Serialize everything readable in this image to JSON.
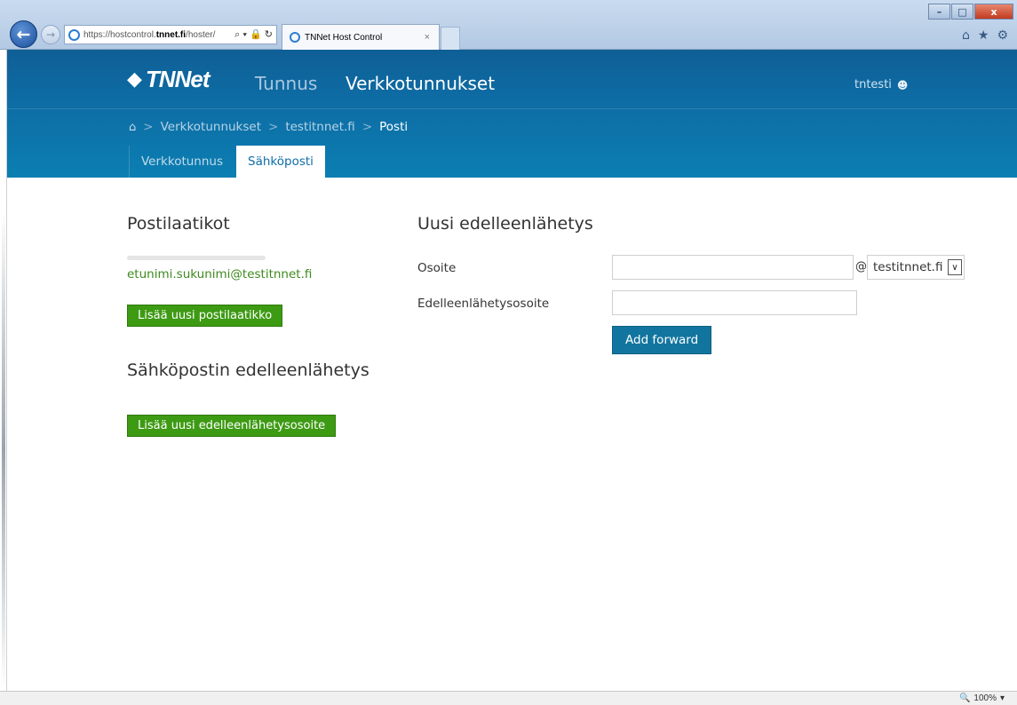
{
  "browser": {
    "address_prefix": "https://hostcontrol.",
    "address_domain": "tnnet.fi",
    "address_suffix": "/hoster/",
    "address_tools": "⌕ ▾ 🔒 ↻",
    "tab_title": "TNNet Host Control",
    "tab_close": "×",
    "back": "←",
    "forward": "→",
    "min": "–",
    "max": "□",
    "close": "x",
    "icons": [
      "home-icon",
      "favorites-star-icon",
      "settings-gear-icon"
    ],
    "icon_glyphs": [
      "⌂",
      "★",
      "⚙"
    ],
    "zoom_icon": "🔍",
    "zoom": "100%",
    "zoom_caret": "▾"
  },
  "header": {
    "logo_text": "TNNet",
    "logo_glyph": "◆",
    "nav_tunnus": "Tunnus",
    "nav_verkkotunnukset": "Verkkotunnukset",
    "username": "tntesti",
    "user_glyph": "☻"
  },
  "breadcrumb": {
    "home_glyph": "⌂",
    "sep": ">",
    "items": [
      "Verkkotunnukset",
      "testitnnet.fi",
      "Posti"
    ]
  },
  "tabs": [
    "Verkkotunnus",
    "Sähköposti"
  ],
  "left": {
    "mailboxes_title": "Postilaatikot",
    "mailbox": "etunimi.sukunimi@testitnnet.fi",
    "add_mailbox": "Lisää uusi postilaatikko",
    "forward_title": "Sähköpostin edelleenlähetys",
    "add_forward": "Lisää uusi edelleenlähetysosoite"
  },
  "form": {
    "title": "Uusi edelleenlähetys",
    "address_label": "Osoite",
    "address_value": "",
    "at": "@",
    "domain_selected": "testitnnet.fi",
    "domain_arrow": "∨",
    "forward_label": "Edelleenlähetysosoite",
    "forward_value": "",
    "submit": "Add forward"
  },
  "colors": {
    "navbar": "#0e6ea6",
    "green_button": "#3d9a13",
    "blue_button": "#12759f",
    "link_green": "#3d8a1d"
  }
}
